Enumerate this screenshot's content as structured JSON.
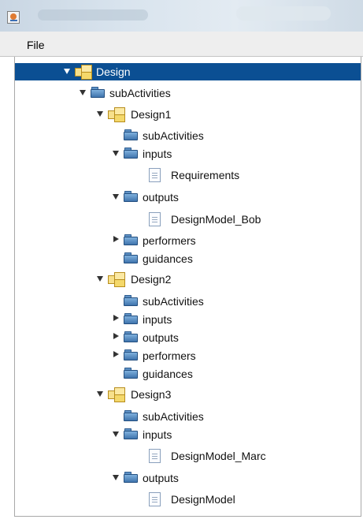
{
  "menu": {
    "file": "File"
  },
  "tree": {
    "design": "Design",
    "subactivities": "subActivities",
    "design1": {
      "label": "Design1",
      "subactivities": "subActivities",
      "inputs": "inputs",
      "requirements": "Requirements",
      "outputs": "outputs",
      "designmodel_bob": "DesignModel_Bob",
      "performers": "performers",
      "guidances": "guidances"
    },
    "design2": {
      "label": "Design2",
      "subactivities": "subActivities",
      "inputs": "inputs",
      "outputs": "outputs",
      "performers": "performers",
      "guidances": "guidances"
    },
    "design3": {
      "label": "Design3",
      "subactivities": "subActivities",
      "inputs": "inputs",
      "designmodel_marc": "DesignModel_Marc",
      "outputs": "outputs",
      "designmodel": "DesignModel"
    }
  },
  "colors": {
    "selection": "#0b4f93",
    "folder": "#5f92c6",
    "activity": "#f4d86a"
  },
  "icons": [
    "app-icon",
    "folder-icon",
    "activity-icon",
    "document-icon",
    "expand-arrow-icon",
    "collapse-arrow-icon"
  ]
}
